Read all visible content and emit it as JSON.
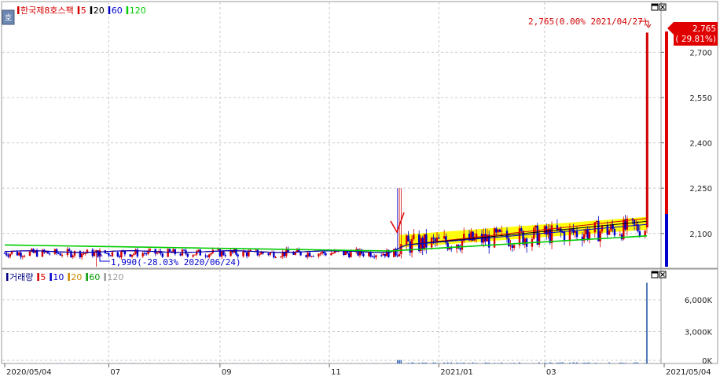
{
  "price_panel": {
    "legend": [
      {
        "text": "한국제8호스팩",
        "color": "#d40000"
      },
      {
        "text": "5",
        "color": "#d40000"
      },
      {
        "text": "20",
        "color": "#000000"
      },
      {
        "text": "60",
        "color": "#0000cc"
      },
      {
        "text": "120",
        "color": "#00cc00"
      }
    ],
    "mode_icon": "호",
    "high_annotation": "2,765(0.00% 2021/04/27)",
    "low_annotation": "1,990(-28.03% 2020/06/24)",
    "current_price_label": "2,765",
    "current_change_label": "( 29.81%)",
    "window_icons": [
      "restore-icon",
      "close-icon"
    ]
  },
  "volume_panel": {
    "legend": [
      {
        "text": "거래량",
        "color": "#000080"
      },
      {
        "text": "5",
        "color": "#d40000"
      },
      {
        "text": "10",
        "color": "#0000cc"
      },
      {
        "text": "20",
        "color": "#cc8800"
      },
      {
        "text": "60",
        "color": "#009900"
      },
      {
        "text": "120",
        "color": "#999999"
      }
    ],
    "window_icons": [
      "restore-icon",
      "close-icon"
    ]
  },
  "x_axis_labels": [
    "2020/05/04",
    "07",
    "09",
    "11",
    "2021/01",
    "03",
    "2021/05/04"
  ],
  "colors": {
    "up": "#d40000",
    "down": "#0000cc",
    "ma5": "#d40000",
    "ma20": "#000000",
    "ma60": "#0000cc",
    "ma120": "#00cc00",
    "band": "#ffff00",
    "grid": "#c8c8c8"
  },
  "chart_data": [
    {
      "type": "candlestick",
      "x_range": [
        "2020/05/04",
        "2021/05/04"
      ],
      "ylim": [
        1990,
        2800
      ],
      "y_ticks": [
        "2,100",
        "2,250",
        "2,400",
        "2,550",
        "2,700"
      ],
      "tick_values": [
        2100,
        2250,
        2400,
        2550,
        2700
      ],
      "price_segments": [
        {
          "from": "2020/05/04",
          "to": "2020/12/09",
          "base": 2035,
          "amp": 14
        },
        {
          "from": "2020/12/10",
          "to": "2021/04/26",
          "base_start": 2060,
          "base_end": 2120,
          "amp": 35
        }
      ],
      "spike_high_2020_12": 2250,
      "last_close": 2765,
      "high": {
        "value": 2765,
        "date": "2021/04/27",
        "change": "0.00%"
      },
      "low": {
        "value": 1990,
        "date": "2020/06/24",
        "change": "-28.03%"
      },
      "moving_averages": [
        {
          "name": "5",
          "from": 2040,
          "to": 2130
        },
        {
          "name": "20",
          "from": 2040,
          "to": 2120
        },
        {
          "name": "60",
          "from": 2040,
          "to": 2110
        },
        {
          "name": "120",
          "from": 2062,
          "to": 2092
        }
      ]
    },
    {
      "type": "bar",
      "series": [
        {
          "name": "거래량"
        }
      ],
      "ylim": [
        0,
        8000000
      ],
      "y_ticks": [
        "0K",
        "3,000K",
        "6,000K"
      ],
      "tick_values": [
        0,
        3000000,
        6000000
      ],
      "last_volume": 7600000
    }
  ]
}
